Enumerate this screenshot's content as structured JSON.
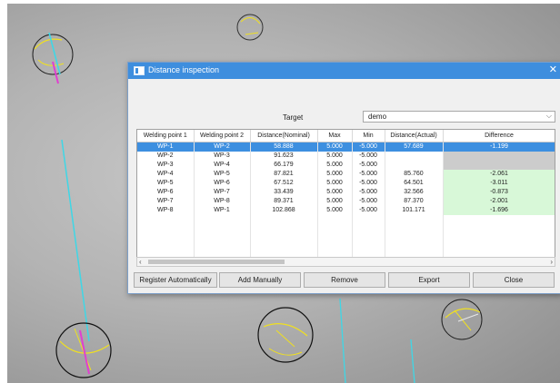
{
  "dialog": {
    "title": "Distance inspection",
    "close_glyph": "✕",
    "target_label": "Target",
    "target_value": "demo",
    "columns": [
      "Welding point 1",
      "Welding point 2",
      "Distance(Nominal)",
      "Max",
      "Min",
      "Distance(Actual)",
      "Difference"
    ],
    "rows": [
      {
        "wp1": "WP-1",
        "wp2": "WP-2",
        "nominal": "58.888",
        "max": "5.000",
        "min": "-5.000",
        "actual": "57.689",
        "diff": "-1.199",
        "state": "selected"
      },
      {
        "wp1": "WP-2",
        "wp2": "WP-3",
        "nominal": "91.623",
        "max": "5.000",
        "min": "-5.000",
        "actual": "",
        "diff": "",
        "state": "missing"
      },
      {
        "wp1": "WP-3",
        "wp2": "WP-4",
        "nominal": "66.179",
        "max": "5.000",
        "min": "-5.000",
        "actual": "",
        "diff": "",
        "state": "missing"
      },
      {
        "wp1": "WP-4",
        "wp2": "WP-5",
        "nominal": "87.821",
        "max": "5.000",
        "min": "-5.000",
        "actual": "85.760",
        "diff": "-2.061",
        "state": "ok"
      },
      {
        "wp1": "WP-5",
        "wp2": "WP-6",
        "nominal": "67.512",
        "max": "5.000",
        "min": "-5.000",
        "actual": "64.501",
        "diff": "-3.011",
        "state": "ok"
      },
      {
        "wp1": "WP-6",
        "wp2": "WP-7",
        "nominal": "33.439",
        "max": "5.000",
        "min": "-5.000",
        "actual": "32.566",
        "diff": "-0.873",
        "state": "ok"
      },
      {
        "wp1": "WP-7",
        "wp2": "WP-8",
        "nominal": "89.371",
        "max": "5.000",
        "min": "-5.000",
        "actual": "87.370",
        "diff": "-2.001",
        "state": "ok"
      },
      {
        "wp1": "WP-8",
        "wp2": "WP-1",
        "nominal": "102.868",
        "max": "5.000",
        "min": "-5.000",
        "actual": "101.171",
        "diff": "-1.696",
        "state": "ok"
      }
    ],
    "empty_rows": 6,
    "buttons": {
      "register": "Register Automatically",
      "add": "Add Manually",
      "remove": "Remove",
      "export": "Export",
      "close": "Close"
    }
  },
  "colors": {
    "titlebar": "#3e8ede",
    "selection": "#3d8fe0",
    "diff_ok": "#d8f8d8",
    "diff_missing": "#cccccc",
    "cyan_line": "#3fd7e6",
    "magenta_marker": "#e040d0",
    "yellow_marker": "#f0e020"
  },
  "icons": [
    "window-icon",
    "close-icon",
    "chevron-down-icon",
    "chevron-left-icon",
    "chevron-right-icon",
    "welding-sphere-icon"
  ]
}
